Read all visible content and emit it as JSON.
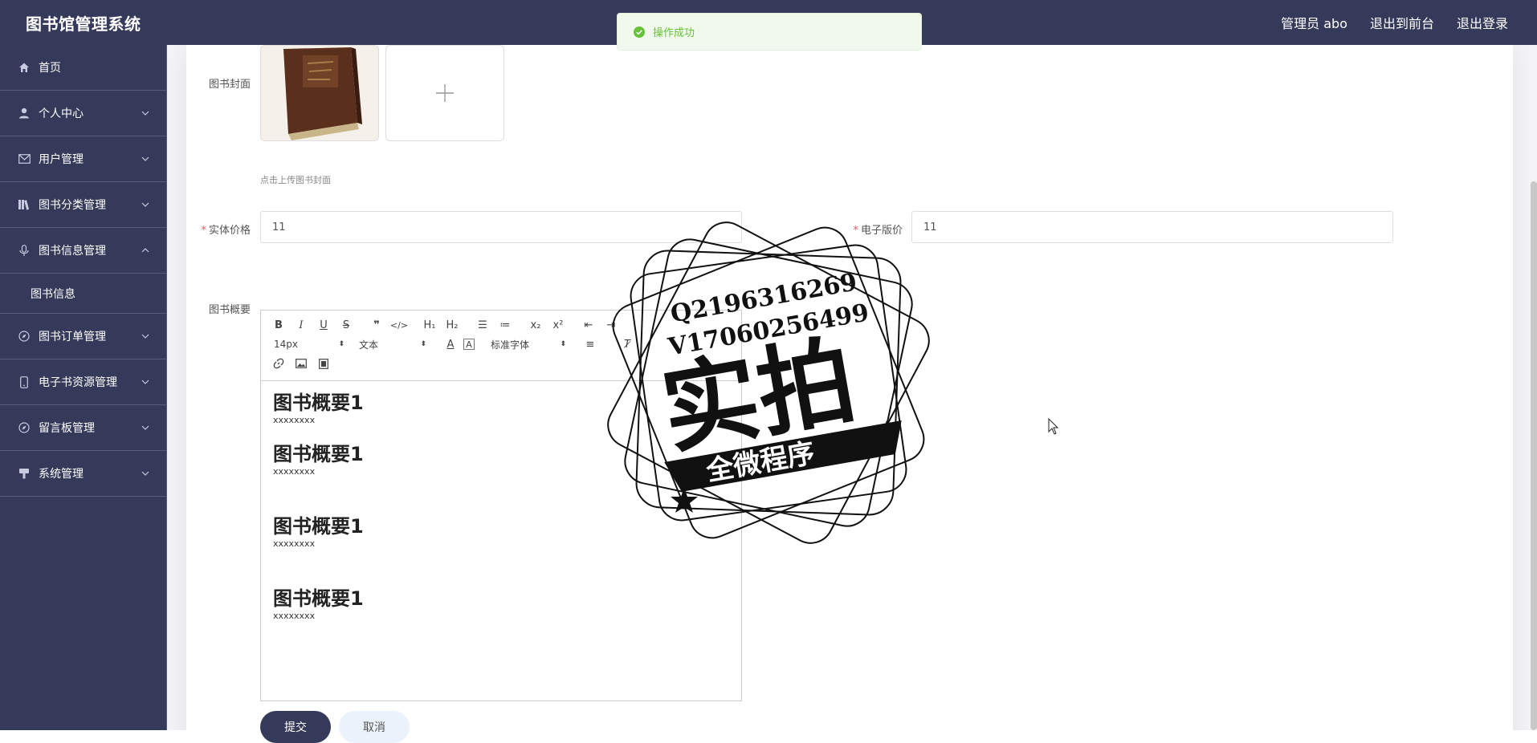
{
  "app": {
    "title": "图书馆管理系统",
    "user_label": "管理员 abo",
    "front_link": "退出到前台",
    "logout_link": "退出登录"
  },
  "sidebar": {
    "items": [
      {
        "label": "首页",
        "icon": "home-icon"
      },
      {
        "label": "个人中心",
        "icon": "user-icon"
      },
      {
        "label": "用户管理",
        "icon": "mail-icon"
      },
      {
        "label": "图书分类管理",
        "icon": "books-icon"
      },
      {
        "label": "图书信息管理",
        "icon": "microphone-icon",
        "sub": "图书信息"
      },
      {
        "label": "图书订单管理",
        "icon": "compass-icon"
      },
      {
        "label": "电子书资源管理",
        "icon": "phone-icon"
      },
      {
        "label": "留言板管理",
        "icon": "compass-icon"
      },
      {
        "label": "系统管理",
        "icon": "brush-icon"
      }
    ]
  },
  "form": {
    "cover_label": "图书封面",
    "cover_hint": "点击上传图书封面",
    "price_label": "实体价格",
    "price_value": "11",
    "eprice_label": "电子版价",
    "eprice_value": "11",
    "summary_label": "图书概要",
    "submit_label": "提交",
    "cancel_label": "取消"
  },
  "editor": {
    "font_size": "14px",
    "block_type": "文本",
    "font_family": "标准字体",
    "blocks": [
      {
        "heading": "图书概要1",
        "text": "xxxxxxxx"
      },
      {
        "heading": "图书概要1",
        "text": "xxxxxxxx"
      },
      {
        "heading": "图书概要1",
        "text": "xxxxxxxx"
      },
      {
        "heading": "图书概要1",
        "text": "xxxxxxxx"
      }
    ]
  },
  "toast": {
    "message": "操作成功"
  },
  "watermark": {
    "line1": "Q2196316269",
    "line2": "V17060256499",
    "main": "实拍",
    "banner": "全微程序"
  }
}
